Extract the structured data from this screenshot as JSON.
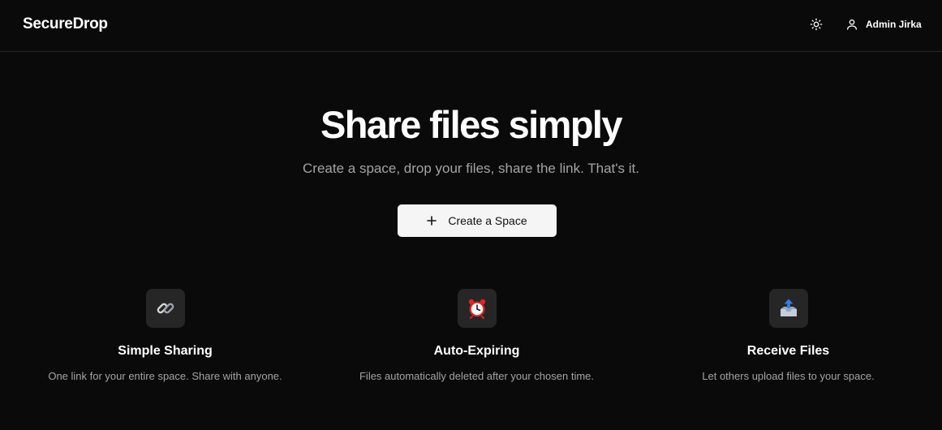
{
  "header": {
    "brand": "SecureDrop",
    "theme_icon": "sun-icon",
    "user_icon": "user-icon",
    "user_name": "Admin Jirka"
  },
  "hero": {
    "title": "Share files simply",
    "subtitle": "Create a space, drop your files, share the link. That's it.",
    "cta_icon": "plus-icon",
    "cta_label": "Create a Space"
  },
  "features": [
    {
      "icon": "link-icon",
      "title": "Simple Sharing",
      "description": "One link for your entire space. Share with anyone."
    },
    {
      "icon": "alarm-clock-icon",
      "title": "Auto-Expiring",
      "description": "Files automatically deleted after your chosen time."
    },
    {
      "icon": "outbox-tray-icon",
      "title": "Receive Files",
      "description": "Let others upload files to your space."
    }
  ],
  "colors": {
    "background": "#0a0a0a",
    "button_bg": "#f5f5f5",
    "muted_text": "#a3a3a3",
    "icon_tile": "#262626"
  }
}
